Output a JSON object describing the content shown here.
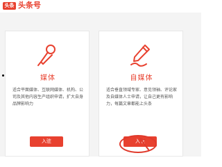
{
  "header": {
    "logo_badge": "头条",
    "logo_text": "头条号"
  },
  "cards": [
    {
      "icon": "microphone-icon",
      "title": "媒体",
      "description": "适合平面媒体、互联网媒体、机构、公司及其他内容生产组织申请，扩大自身品牌影响力",
      "button_label": "入驻"
    },
    {
      "icon": "pen-signature-icon",
      "title": "自媒体",
      "description": "适合垂直领域专家、意见领袖、评论家及自媒体人士申请，让自己更有影响力，每篇文章都能上头条",
      "button_label": "入驻"
    }
  ],
  "colors": {
    "brand_red": "#e8412f",
    "annotation_red": "#e03a2c"
  }
}
